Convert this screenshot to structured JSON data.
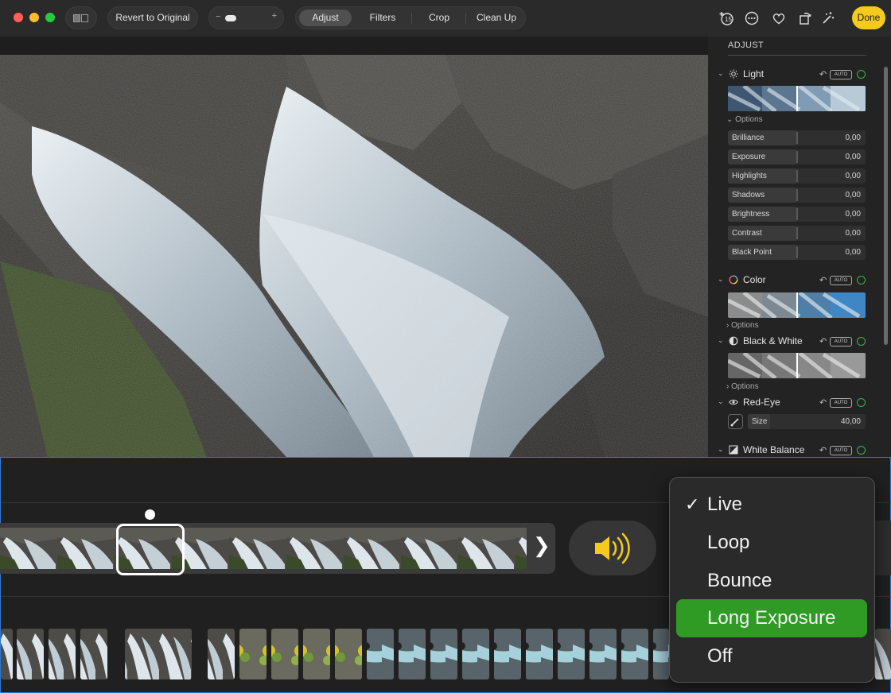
{
  "toolbar": {
    "revert_label": "Revert to Original",
    "zoom_minus": "−",
    "zoom_plus": "+",
    "tabs": [
      {
        "label": "Adjust",
        "active": true
      },
      {
        "label": "Filters",
        "active": false
      },
      {
        "label": "Crop",
        "active": false
      },
      {
        "label": "Clean Up",
        "active": false
      }
    ],
    "icons": [
      "extensions-icon",
      "more-icon",
      "favorite-heart-icon",
      "rotate-icon",
      "auto-enhance-icon"
    ],
    "done_label": "Done"
  },
  "panel": {
    "title": "ADJUST",
    "auto_label": "AUTO",
    "options_label": "Options",
    "sections": {
      "light": {
        "label": "Light",
        "icon": "sun-icon"
      },
      "color": {
        "label": "Color",
        "icon": "color-circle-icon"
      },
      "bw": {
        "label": "Black & White",
        "icon": "half-circle-icon"
      },
      "redeye": {
        "label": "Red-Eye",
        "icon": "eye-icon"
      },
      "wb": {
        "label": "White Balance",
        "icon": "white-balance-icon"
      }
    },
    "light_sliders": [
      {
        "label": "Brilliance",
        "value": "0,00"
      },
      {
        "label": "Exposure",
        "value": "0,00"
      },
      {
        "label": "Highlights",
        "value": "0,00"
      },
      {
        "label": "Shadows",
        "value": "0,00"
      },
      {
        "label": "Brightness",
        "value": "0,00"
      },
      {
        "label": "Contrast",
        "value": "0,00"
      },
      {
        "label": "Black Point",
        "value": "0,00"
      }
    ],
    "redeye_size": {
      "label": "Size",
      "value": "40,00"
    }
  },
  "live_menu": {
    "items": [
      {
        "label": "Live",
        "checked": true,
        "selected": false
      },
      {
        "label": "Loop",
        "checked": false,
        "selected": false
      },
      {
        "label": "Bounce",
        "checked": false,
        "selected": false
      },
      {
        "label": "Long Exposure",
        "checked": false,
        "selected": true
      },
      {
        "label": "Off",
        "checked": false,
        "selected": false
      }
    ],
    "check_glyph": "✓"
  },
  "colors": {
    "accent_yellow": "#f4cb1c",
    "menu_selected": "#2f9a24",
    "enabled_ring": "#39b54a",
    "focus_border": "#2a79d6"
  }
}
